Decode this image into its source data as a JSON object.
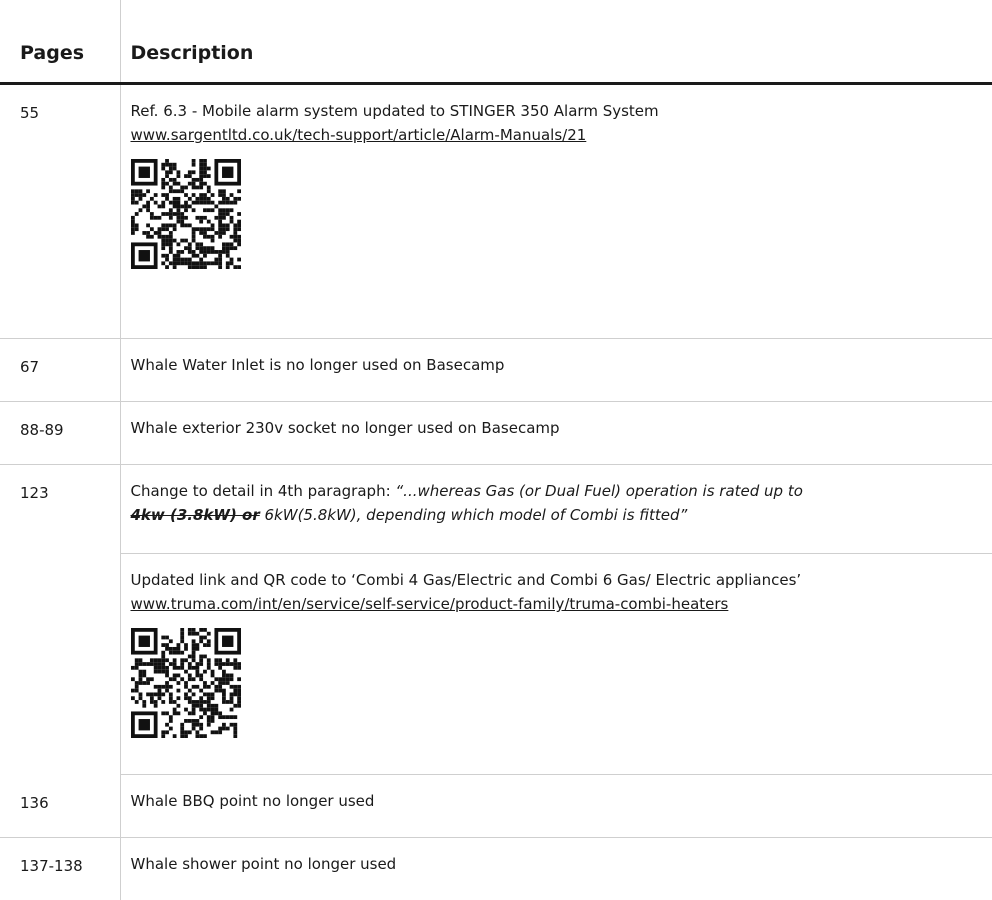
{
  "table": {
    "headers": {
      "pages": "Pages",
      "description": "Description"
    },
    "rows": [
      {
        "pages": "55",
        "text": "Ref. 6.3 - Mobile alarm system updated to STINGER 350 Alarm System",
        "link": "www.sargentltd.co.uk/tech-support/article/Alarm-Manuals/21"
      },
      {
        "pages": "67",
        "text": "Whale Water Inlet is no longer used on Basecamp"
      },
      {
        "pages": "88-89",
        "text": "Whale exterior 230v socket no longer used on Basecamp"
      },
      {
        "pages": "123",
        "intro": "Change to detail in 4th paragraph: ",
        "quote_a": "“...whereas Gas (or Dual Fuel) operation is rated up to",
        "strike": "4kw (3.8kW) or",
        "quote_b": " 6kW(5.8kW), depending which model of Combi is fitted”",
        "text2": "Updated link and QR code to ‘Combi 4 Gas/Electric and Combi 6 Gas/ Electric appliances’",
        "link2": "www.truma.com/int/en/service/self-service/product-family/truma-combi-heaters"
      },
      {
        "pages": "136",
        "text": "Whale BBQ point no longer used"
      },
      {
        "pages": "137-138",
        "text": "Whale shower point no longer used"
      }
    ]
  }
}
